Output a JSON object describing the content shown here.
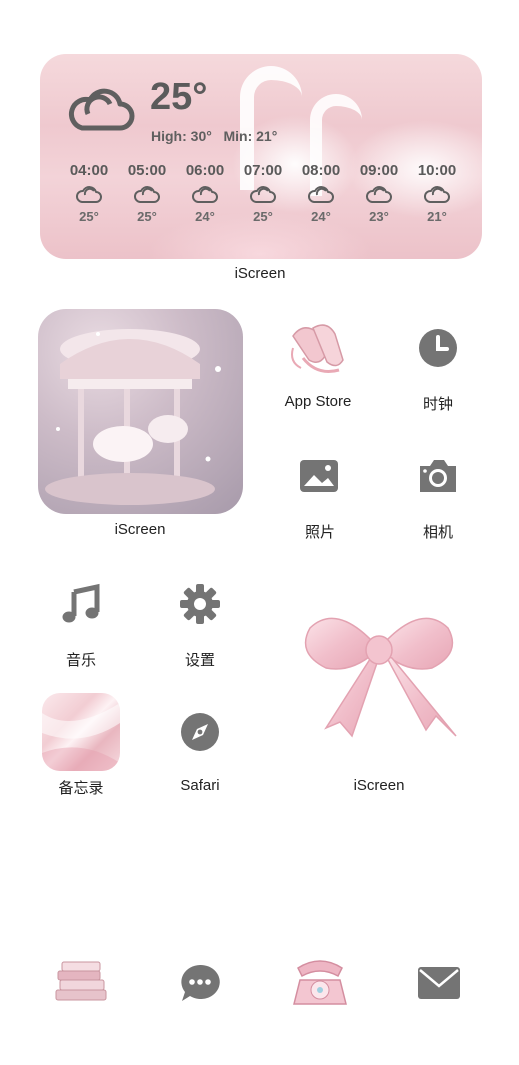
{
  "weather": {
    "current_temp": "25°",
    "high_min": "High: 30°   Min: 21°",
    "hours": [
      {
        "time": "04:00",
        "temp": "25°"
      },
      {
        "time": "05:00",
        "temp": "25°"
      },
      {
        "time": "06:00",
        "temp": "24°"
      },
      {
        "time": "07:00",
        "temp": "25°"
      },
      {
        "time": "08:00",
        "temp": "24°"
      },
      {
        "time": "09:00",
        "temp": "23°"
      },
      {
        "time": "10:00",
        "temp": "21°"
      }
    ],
    "widget_label": "iScreen"
  },
  "apps": {
    "carousel_label": "iScreen",
    "app_store": "App Store",
    "clock": "时钟",
    "photos": "照片",
    "camera": "相机",
    "music": "音乐",
    "settings": "设置",
    "notes": "备忘录",
    "safari": "Safari",
    "bow_label": "iScreen"
  },
  "colors": {
    "icon_gray": "#747474",
    "pink": "#f1c6cf"
  }
}
